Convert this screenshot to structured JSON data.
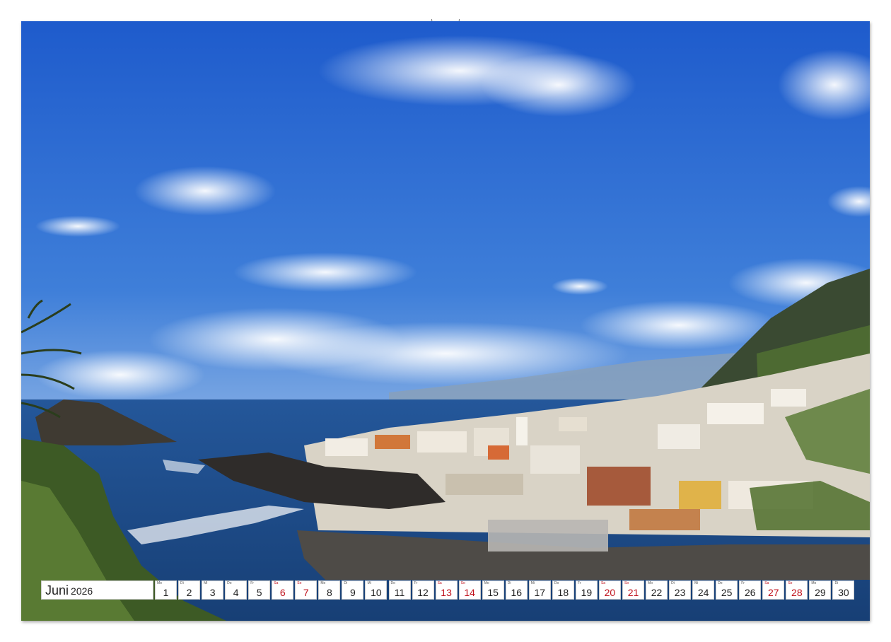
{
  "calendar": {
    "month": "Juni",
    "year": "2026",
    "days": [
      {
        "dow": "Mo",
        "num": "1",
        "weekend": false
      },
      {
        "dow": "Di",
        "num": "2",
        "weekend": false
      },
      {
        "dow": "Mi",
        "num": "3",
        "weekend": false
      },
      {
        "dow": "Do",
        "num": "4",
        "weekend": false
      },
      {
        "dow": "Fr",
        "num": "5",
        "weekend": false
      },
      {
        "dow": "Sa",
        "num": "6",
        "weekend": true
      },
      {
        "dow": "So",
        "num": "7",
        "weekend": true
      },
      {
        "dow": "Mo",
        "num": "8",
        "weekend": false
      },
      {
        "dow": "Di",
        "num": "9",
        "weekend": false
      },
      {
        "dow": "Mi",
        "num": "10",
        "weekend": false
      },
      {
        "dow": "Do",
        "num": "11",
        "weekend": false
      },
      {
        "dow": "Fr",
        "num": "12",
        "weekend": false
      },
      {
        "dow": "Sa",
        "num": "13",
        "weekend": true
      },
      {
        "dow": "So",
        "num": "14",
        "weekend": true
      },
      {
        "dow": "Mo",
        "num": "15",
        "weekend": false
      },
      {
        "dow": "Di",
        "num": "16",
        "weekend": false
      },
      {
        "dow": "Mi",
        "num": "17",
        "weekend": false
      },
      {
        "dow": "Do",
        "num": "18",
        "weekend": false
      },
      {
        "dow": "Fr",
        "num": "19",
        "weekend": false
      },
      {
        "dow": "Sa",
        "num": "20",
        "weekend": true
      },
      {
        "dow": "So",
        "num": "21",
        "weekend": true
      },
      {
        "dow": "Mo",
        "num": "22",
        "weekend": false
      },
      {
        "dow": "Di",
        "num": "23",
        "weekend": false
      },
      {
        "dow": "Mi",
        "num": "24",
        "weekend": false
      },
      {
        "dow": "Do",
        "num": "25",
        "weekend": false
      },
      {
        "dow": "Fr",
        "num": "26",
        "weekend": false
      },
      {
        "dow": "Sa",
        "num": "27",
        "weekend": true
      },
      {
        "dow": "So",
        "num": "28",
        "weekend": true
      },
      {
        "dow": "Mo",
        "num": "29",
        "weekend": false
      },
      {
        "dow": "Di",
        "num": "30",
        "weekend": false
      }
    ]
  },
  "colors": {
    "weekend": "#c0121c",
    "sky_top": "#1f5fcf",
    "sky_bottom": "#bcd3ee",
    "sea": "#1d4f8c"
  }
}
